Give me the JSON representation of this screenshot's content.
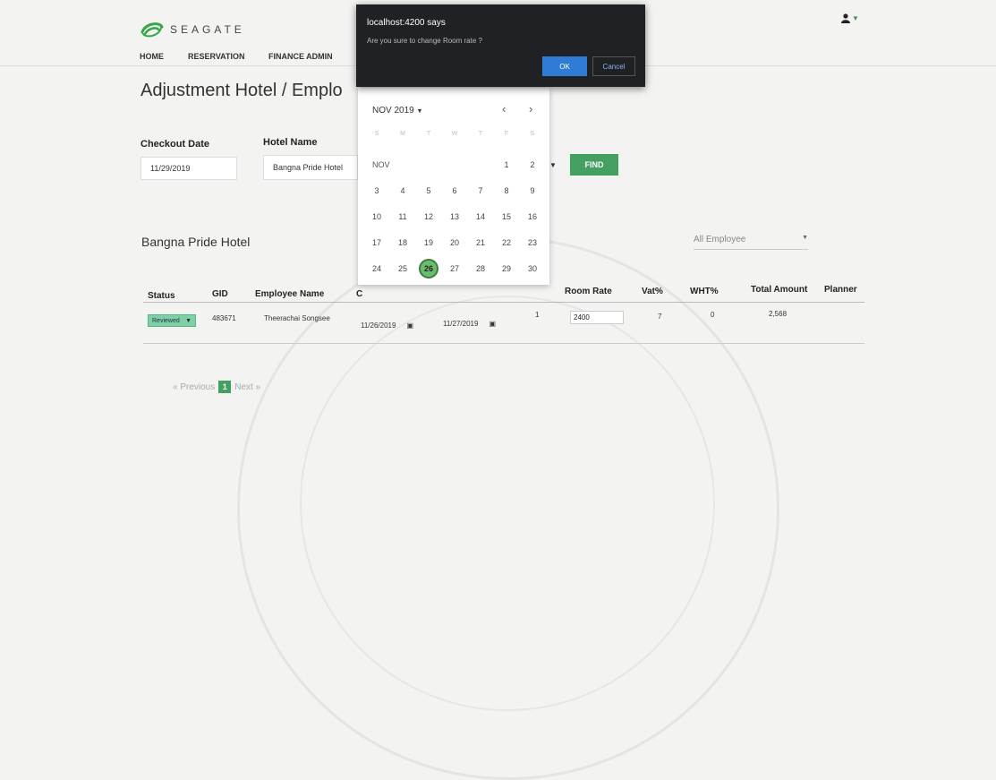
{
  "logo": {
    "text": "SEAGATE"
  },
  "nav": [
    "HOME",
    "RESERVATION",
    "FINANCE ADMIN"
  ],
  "page_title": "Adjustment Hotel / Emplo",
  "filters": {
    "checkout_label": "Checkout Date",
    "checkout_value": "11/29/2019",
    "hotel_label": "Hotel Name",
    "hotel_value": "Bangna Pride Hotel",
    "find_label": "FIND"
  },
  "section_title": "Bangna Pride Hotel",
  "employee_filter": "All Employee",
  "table": {
    "headers": [
      "Status",
      "GID",
      "Employee Name",
      "C",
      "Room Rate",
      "Vat%",
      "WHT%",
      "Total Amount",
      "Planner"
    ],
    "row": {
      "status": "Reviewed",
      "gid": "483671",
      "name": "Theerachai Songsee",
      "checkin": "11/26/2019",
      "checkout": "11/27/2019",
      "nights": "1",
      "room_rate": "2400",
      "vat": "7",
      "wht": "0",
      "total": "2,568"
    }
  },
  "pager": {
    "prev": "« Previous",
    "current": "1",
    "next": "Next »"
  },
  "calendar": {
    "month_label": "NOV 2019",
    "weekdays": [
      "S",
      "M",
      "T",
      "W",
      "T",
      "F",
      "S"
    ],
    "row_label": "NOV",
    "weeks": [
      [
        "",
        "",
        "",
        "",
        "",
        "1",
        "2"
      ],
      [
        "3",
        "4",
        "5",
        "6",
        "7",
        "8",
        "9"
      ],
      [
        "10",
        "11",
        "12",
        "13",
        "14",
        "15",
        "16"
      ],
      [
        "17",
        "18",
        "19",
        "20",
        "21",
        "22",
        "23"
      ],
      [
        "24",
        "25",
        "26",
        "27",
        "28",
        "29",
        "30"
      ]
    ],
    "selected": "26"
  },
  "alert": {
    "title": "localhost:4200 says",
    "message": "Are you sure to change Room rate ?",
    "ok": "OK",
    "cancel": "Cancel"
  },
  "colors": {
    "accent": "#43a060",
    "dialog_bg": "#202124",
    "ok_button": "#2f7bd6"
  }
}
